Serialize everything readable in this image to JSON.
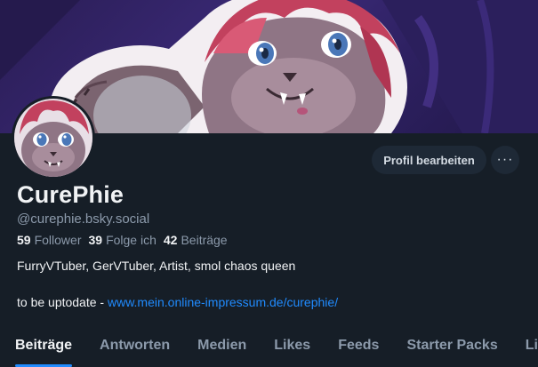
{
  "profile": {
    "display_name": "CurePhie",
    "handle": "@curephie.bsky.social",
    "bio": "FurryVTuber, GerVTuber, Artist, smol chaos queen",
    "bio_link_prefix": "to be uptodate - ",
    "bio_link": "www.mein.online-impressum.de/curephie/"
  },
  "stats": {
    "followers_count": "59",
    "followers_label": "Follower",
    "following_count": "39",
    "following_label": "Folge ich",
    "posts_count": "42",
    "posts_label": "Beiträge"
  },
  "actions": {
    "edit_profile_label": "Profil bearbeiten",
    "more_label": "···"
  },
  "tabs": [
    {
      "label": "Beiträge",
      "active": true
    },
    {
      "label": "Antworten",
      "active": false
    },
    {
      "label": "Medien",
      "active": false
    },
    {
      "label": "Likes",
      "active": false
    },
    {
      "label": "Feeds",
      "active": false
    },
    {
      "label": "Starter Packs",
      "active": false
    },
    {
      "label": "List",
      "active": false
    }
  ],
  "colors": {
    "background": "#161e27",
    "accent": "#208bfe",
    "muted_text": "#8c9aab",
    "button_bg": "#1e2936"
  }
}
